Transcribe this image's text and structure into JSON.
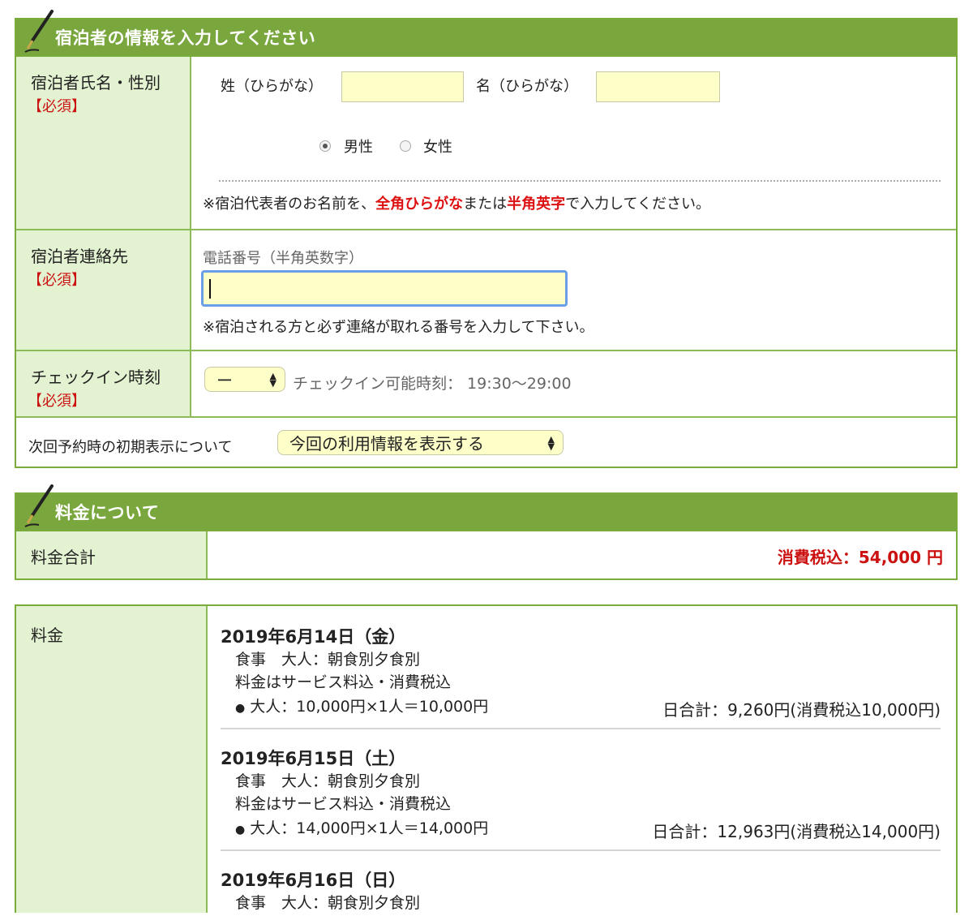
{
  "guest_section": {
    "title": "宿泊者の情報を入力してください",
    "name_row": {
      "label": "宿泊者氏名・性別",
      "required": "【必須】",
      "last_name_label": "姓（ひらがな）",
      "last_name_value": "",
      "first_name_label": "名（ひらがな）",
      "first_name_value": "",
      "gender_options": [
        "男性",
        "女性"
      ],
      "gender_selected": "男性",
      "note_prefix": "※宿泊代表者のお名前を、",
      "note_hl1": "全角ひらがな",
      "note_mid": "または",
      "note_hl2": "半角英字",
      "note_suffix": "で入力してください。"
    },
    "contact_row": {
      "label": "宿泊者連絡先",
      "required": "【必須】",
      "phone_label": "電話番号（半角英数字）",
      "phone_value": "",
      "note": "※宿泊される方と必ず連絡が取れる番号を入力して下さい。"
    },
    "checkin_row": {
      "label": "チェックイン時刻",
      "required": "【必須】",
      "selected": "ー",
      "hint": "チェックイン可能時刻： 19:30〜29:00"
    },
    "next_display_row": {
      "label": "次回予約時の初期表示について",
      "selected": "今回の利用情報を表示する"
    }
  },
  "fee_section": {
    "title": "料金について",
    "total_label": "料金合計",
    "total_value": "消費税込：54,000 円"
  },
  "breakdown": {
    "label": "料金",
    "days": [
      {
        "date": "2019年6月14日（金）",
        "meal": "食事　大人：朝食別夕食別",
        "tax_note": "料金はサービス料込・消費税込",
        "detail": "大人：10,000円×1人＝10,000円",
        "day_total": "日合計：9,260円(消費税込10,000円)"
      },
      {
        "date": "2019年6月15日（土）",
        "meal": "食事　大人：朝食別夕食別",
        "tax_note": "料金はサービス料込・消費税込",
        "detail": "大人：14,000円×1人＝14,000円",
        "day_total": "日合計：12,963円(消費税込14,000円)"
      },
      {
        "date": "2019年6月16日（日）",
        "meal": "食事　大人：朝食別夕食別"
      }
    ]
  },
  "colors": {
    "header_green": "#79a63d",
    "label_bg": "#e3f3d1",
    "input_bg": "#fefec8",
    "required_red": "#cc1111",
    "focus_blue": "#6a9ee6"
  }
}
